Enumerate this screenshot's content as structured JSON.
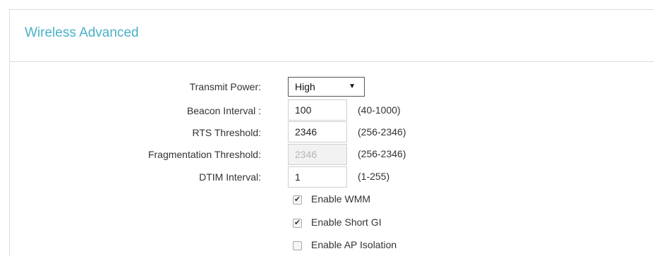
{
  "section": {
    "title": "Wireless Advanced"
  },
  "transmit_power": {
    "label": "Transmit Power:",
    "value": "High",
    "arrow": "▼"
  },
  "beacon_interval": {
    "label": "Beacon Interval :",
    "value": "100",
    "range": "(40-1000)"
  },
  "rts_threshold": {
    "label": "RTS Threshold:",
    "value": "2346",
    "range": "(256-2346)"
  },
  "fragmentation_threshold": {
    "label": "Fragmentation Threshold:",
    "value": "2346",
    "range": "(256-2346)",
    "disabled": true
  },
  "dtim_interval": {
    "label": "DTIM Interval:",
    "value": "1",
    "range": "(1-255)"
  },
  "options": [
    {
      "label": "Enable WMM",
      "checked": true,
      "mark": "✔"
    },
    {
      "label": "Enable Short GI",
      "checked": true,
      "mark": "✔"
    },
    {
      "label": "Enable AP Isolation",
      "checked": false,
      "mark": ""
    }
  ],
  "colors": {
    "title": "#4bb0c8",
    "border": "#dcdcdc",
    "disabled_bg": "#f2f2f2"
  }
}
